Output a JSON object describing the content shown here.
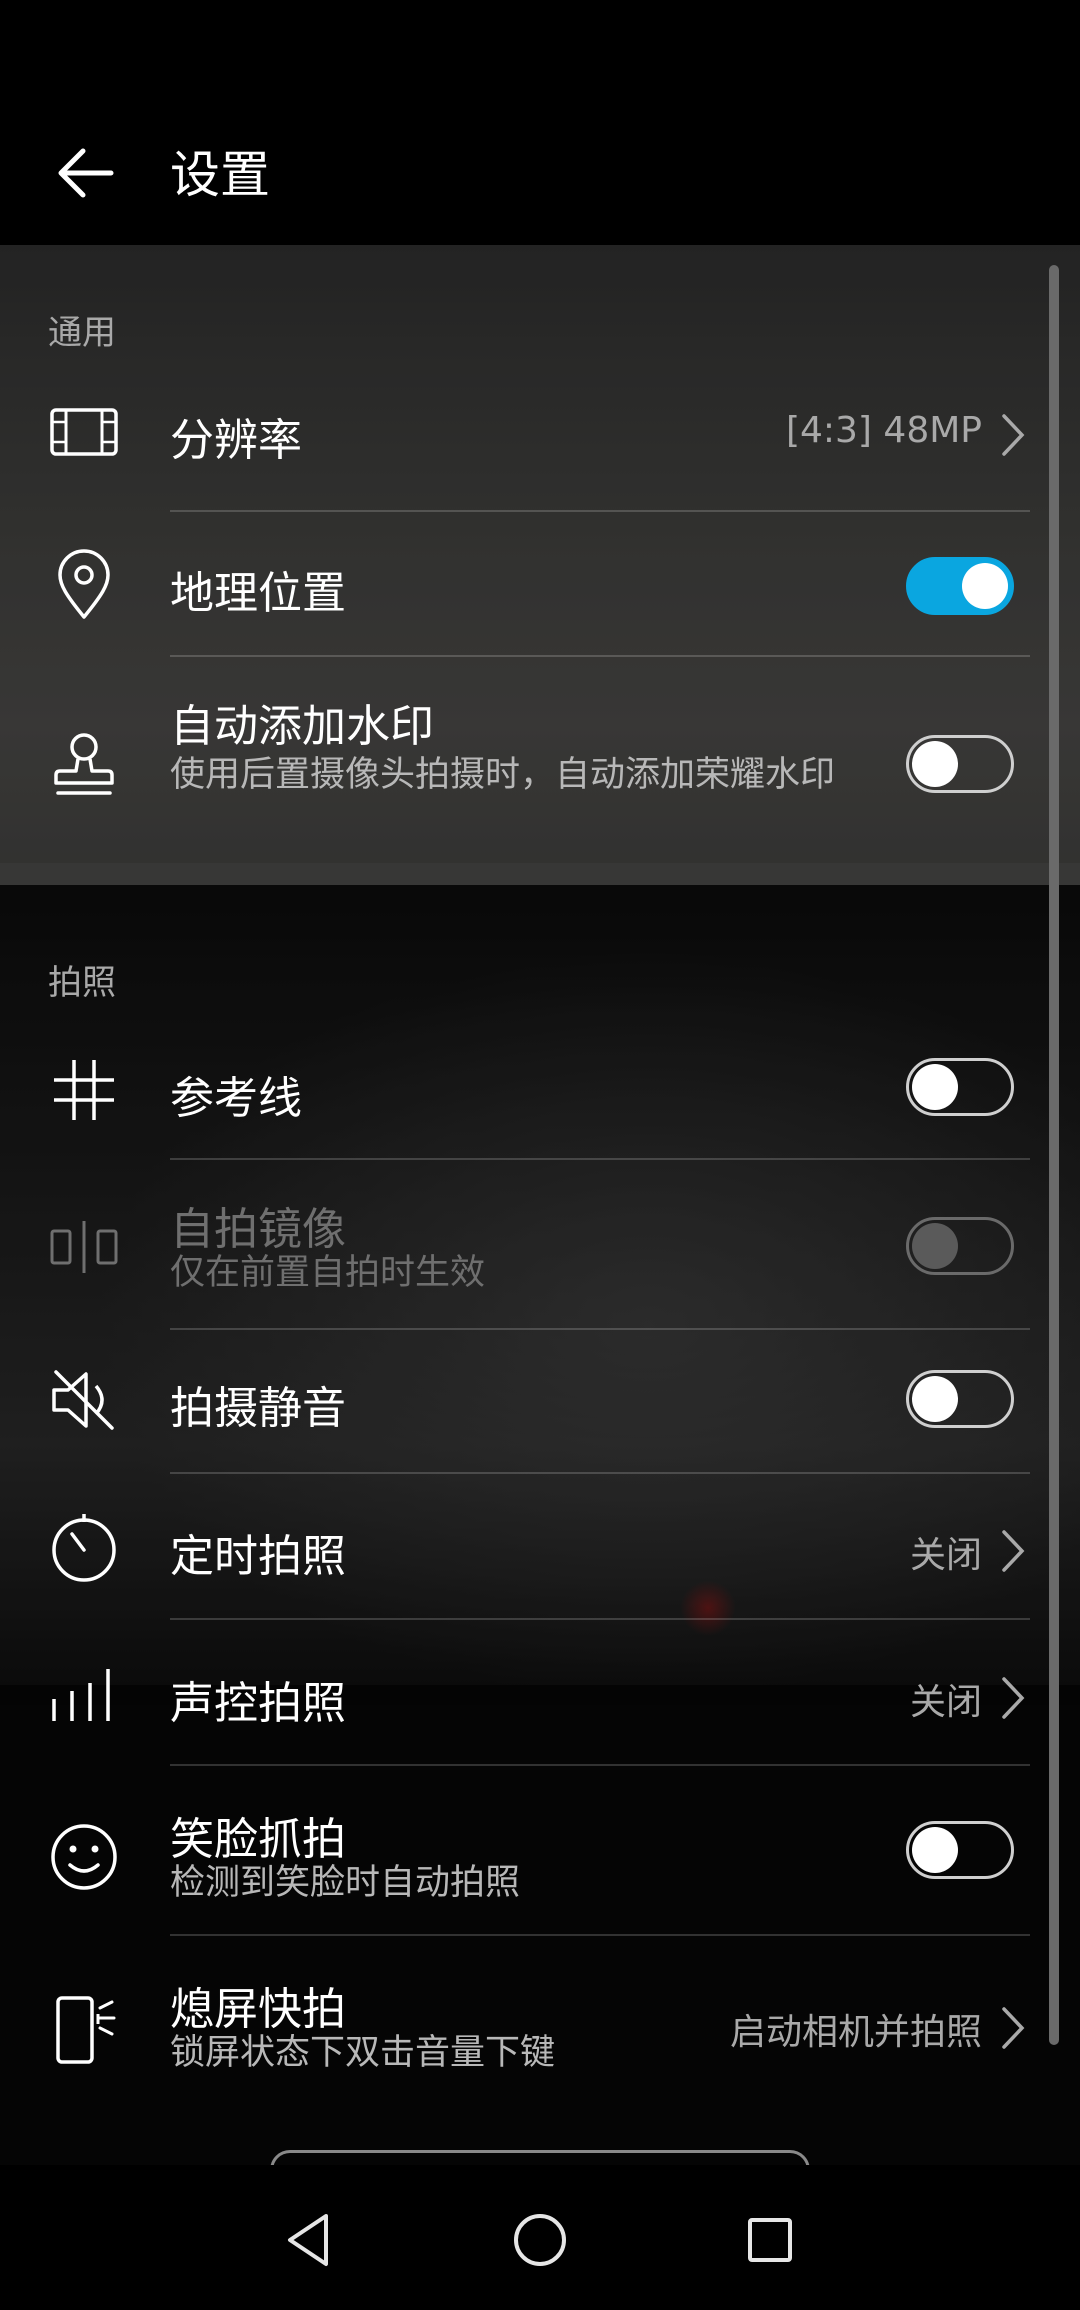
{
  "header": {
    "title": "设置"
  },
  "sections": {
    "general": "通用",
    "photo": "拍照"
  },
  "general": {
    "resolution": {
      "label": "分辨率",
      "value": "[4:3] 48MP",
      "icon": "film-frame-icon"
    },
    "location": {
      "label": "地理位置",
      "toggle": "on",
      "icon": "location-pin-icon"
    },
    "watermark": {
      "label": "自动添加水印",
      "sub": "使用后置摄像头拍摄时，自动添加荣耀水印",
      "toggle": "off",
      "icon": "stamp-icon"
    }
  },
  "photo": {
    "gridlines": {
      "label": "参考线",
      "toggle": "off",
      "icon": "grid-icon"
    },
    "mirror": {
      "label": "自拍镜像",
      "sub": "仅在前置自拍时生效",
      "toggle": "off-disabled",
      "icon": "mirror-icon"
    },
    "mute": {
      "label": "拍摄静音",
      "toggle": "off",
      "icon": "speaker-muted-icon"
    },
    "timer": {
      "label": "定时拍照",
      "value": "关闭",
      "icon": "timer-icon"
    },
    "voice": {
      "label": "声控拍照",
      "value": "关闭",
      "icon": "sound-bars-icon"
    },
    "smile": {
      "label": "笑脸抓拍",
      "sub": "检测到笑脸时自动拍照",
      "toggle": "off",
      "icon": "smile-icon"
    },
    "snapshot": {
      "label": "熄屏快拍",
      "sub": "锁屏状态下双击音量下键",
      "value": "启动相机并拍照",
      "icon": "phone-shortcut-icon"
    }
  },
  "navbar": {
    "icons": [
      "back-triangle-icon",
      "home-circle-icon",
      "recents-square-icon"
    ]
  }
}
